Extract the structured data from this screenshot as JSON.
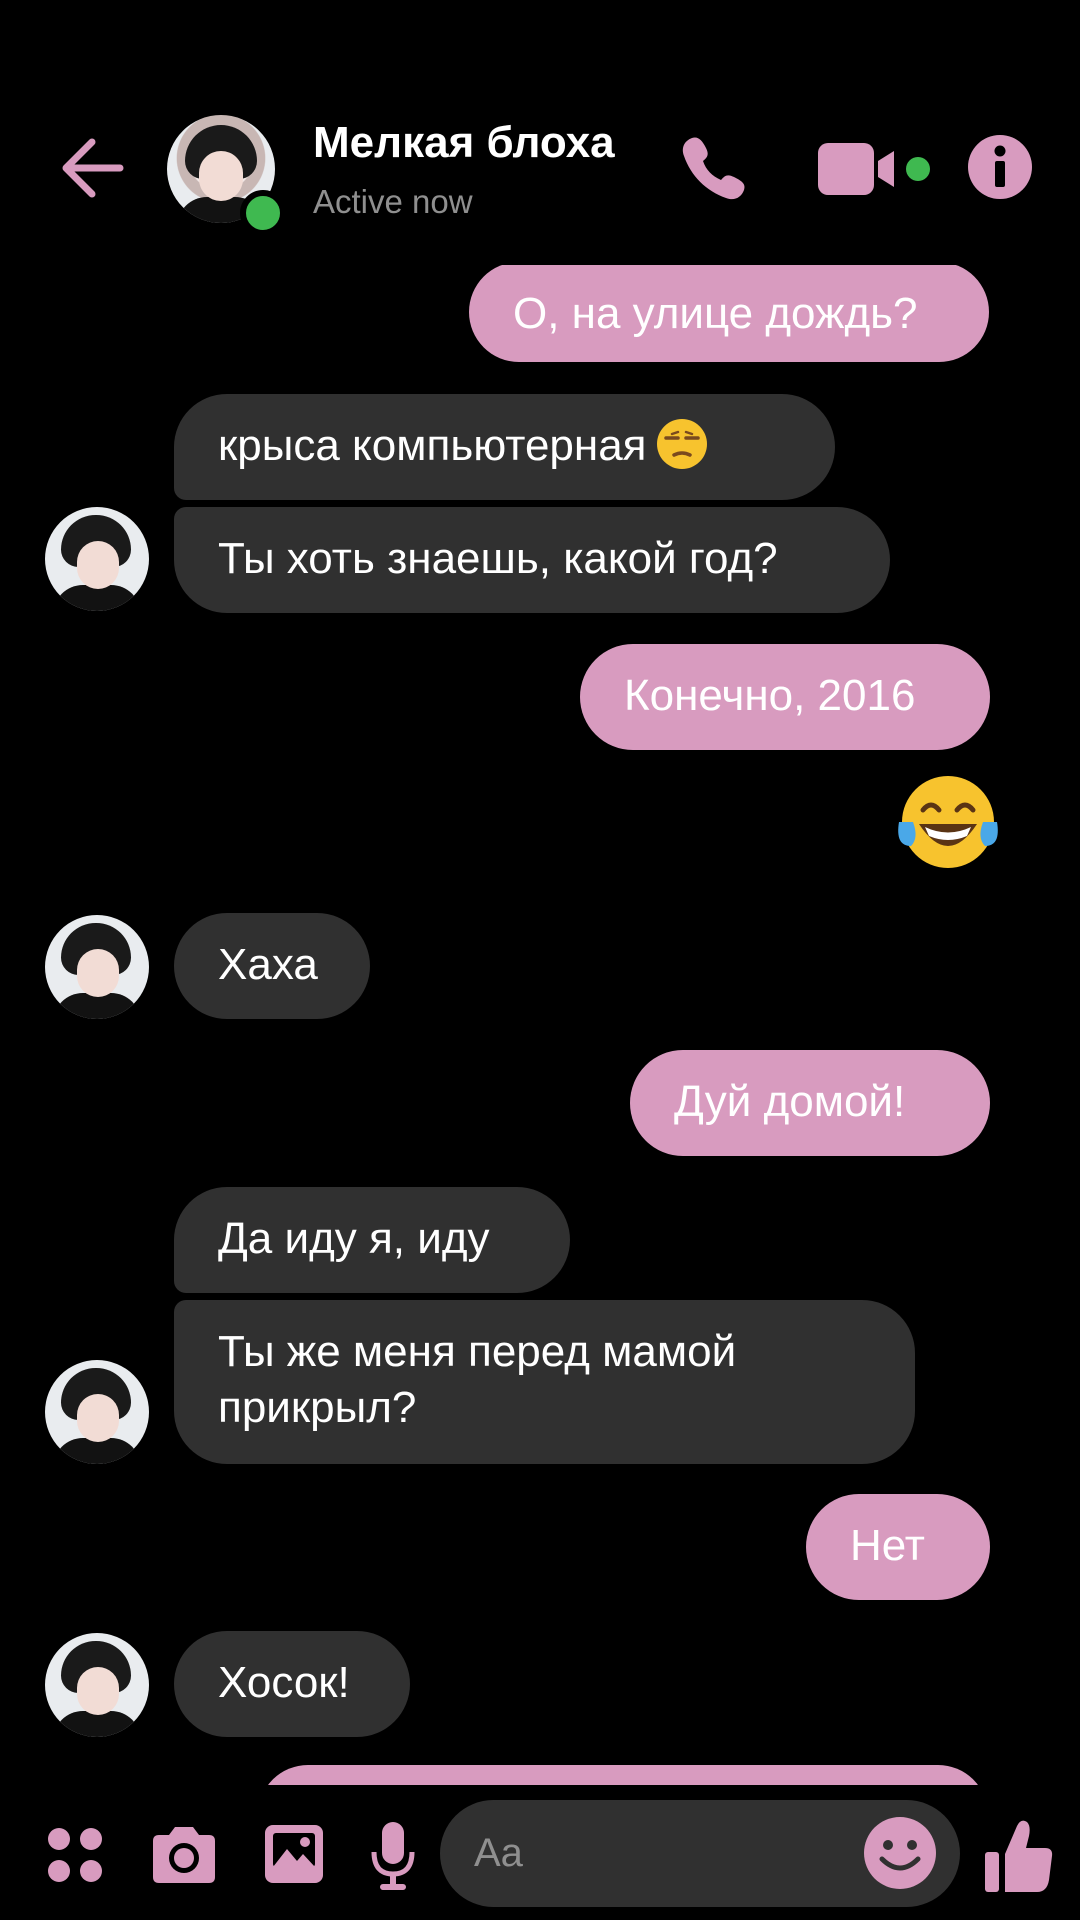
{
  "colors": {
    "accent": "#d89bbf",
    "incoming_bubble": "#303030",
    "background": "#000000",
    "online": "#3fb950",
    "muted_text": "#8f8f8f"
  },
  "header": {
    "back_icon": "arrow-left-icon",
    "contact_name": "Мелкая блоха",
    "status": "Active now",
    "icons": [
      "phone-icon",
      "video-camera-icon",
      "info-icon"
    ]
  },
  "messages": [
    {
      "direction": "out",
      "text": "О, на улице дождь?"
    },
    {
      "direction": "in",
      "text": "крыса компьютерная",
      "emoji": "unamused-face-icon"
    },
    {
      "direction": "in",
      "text": "Ты хоть знаешь, какой год?"
    },
    {
      "direction": "out",
      "text": "Конечно, 2016"
    },
    {
      "direction": "out",
      "emoji": "tears-of-joy-icon"
    },
    {
      "direction": "in",
      "text": "Хаха"
    },
    {
      "direction": "out",
      "text": "Дуй домой!"
    },
    {
      "direction": "in",
      "text": "Да иду я, иду"
    },
    {
      "direction": "in",
      "text_line1": "Ты же меня перед мамой",
      "text_line2": "прикрыл?"
    },
    {
      "direction": "out",
      "text": "Нет"
    },
    {
      "direction": "in",
      "text": "Хосок!"
    }
  ],
  "composer": {
    "placeholder": "Aa",
    "icons": [
      "apps-icon",
      "camera-icon",
      "gallery-icon",
      "microphone-icon",
      "smiley-icon",
      "thumbs-up-icon"
    ]
  }
}
